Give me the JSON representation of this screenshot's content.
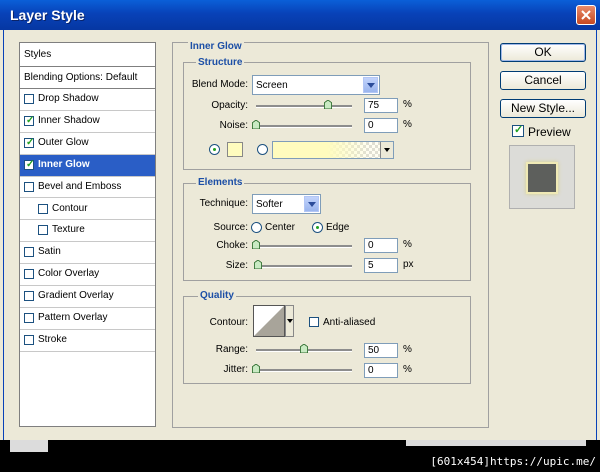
{
  "window": {
    "title": "Layer Style"
  },
  "left_panel": {
    "styles_header": "Styles",
    "blending_options": "Blending Options: Default",
    "items": [
      {
        "label": "Drop Shadow",
        "checked": false,
        "indent": false,
        "selected": false
      },
      {
        "label": "Inner Shadow",
        "checked": true,
        "indent": false,
        "selected": false
      },
      {
        "label": "Outer Glow",
        "checked": true,
        "indent": false,
        "selected": false
      },
      {
        "label": "Inner Glow",
        "checked": true,
        "indent": false,
        "selected": true
      },
      {
        "label": "Bevel and Emboss",
        "checked": false,
        "indent": false,
        "selected": false
      },
      {
        "label": "Contour",
        "checked": false,
        "indent": true,
        "selected": false
      },
      {
        "label": "Texture",
        "checked": false,
        "indent": true,
        "selected": false
      },
      {
        "label": "Satin",
        "checked": false,
        "indent": false,
        "selected": false
      },
      {
        "label": "Color Overlay",
        "checked": false,
        "indent": false,
        "selected": false
      },
      {
        "label": "Gradient Overlay",
        "checked": false,
        "indent": false,
        "selected": false
      },
      {
        "label": "Pattern Overlay",
        "checked": false,
        "indent": false,
        "selected": false
      },
      {
        "label": "Stroke",
        "checked": false,
        "indent": false,
        "selected": false
      }
    ]
  },
  "inner_glow": {
    "title": "Inner Glow",
    "structure": {
      "title": "Structure",
      "blend_mode_label": "Blend Mode:",
      "blend_mode_value": "Screen",
      "opacity_label": "Opacity:",
      "opacity_value": "75",
      "opacity_level": 0.75,
      "opacity_unit": "%",
      "noise_label": "Noise:",
      "noise_value": "0",
      "noise_level": 0,
      "noise_unit": "%",
      "glow_color": "#fffcbe"
    },
    "elements": {
      "title": "Elements",
      "technique_label": "Technique:",
      "technique_value": "Softer",
      "source_label": "Source:",
      "source_center": "Center",
      "source_edge": "Edge",
      "choke_label": "Choke:",
      "choke_value": "0",
      "choke_level": 0,
      "choke_unit": "%",
      "size_label": "Size:",
      "size_value": "5",
      "size_level": 0.02,
      "size_unit": "px"
    },
    "quality": {
      "title": "Quality",
      "contour_label": "Contour:",
      "anti_aliased_label": "Anti-aliased",
      "range_label": "Range:",
      "range_value": "50",
      "range_level": 0.5,
      "range_unit": "%",
      "jitter_label": "Jitter:",
      "jitter_value": "0",
      "jitter_level": 0,
      "jitter_unit": "%"
    }
  },
  "buttons": {
    "ok": "OK",
    "cancel": "Cancel",
    "new_style": "New Style...",
    "preview": "Preview"
  },
  "status_text": "[601x454]https://upic.me/",
  "colors": {
    "title_bar": "#0842b8",
    "selected_row": "#2a5ec6",
    "group_title": "#1c4fa6"
  }
}
